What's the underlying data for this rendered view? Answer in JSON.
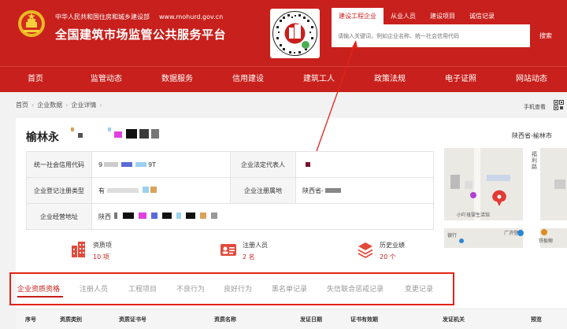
{
  "header": {
    "ministry": "中华人民共和国住房和城乡建设部",
    "url": "www.mohurd.gov.cn",
    "title": "全国建筑市场监管公共服务平台"
  },
  "search": {
    "tabs": [
      "建设工程企业",
      "从业人员",
      "建设项目",
      "诚信记录"
    ],
    "placeholder": "请输入关键词，例如企业名称、统一社会信用代码",
    "button": "搜索"
  },
  "nav": [
    "首页",
    "监管动态",
    "数据服务",
    "信用建设",
    "建筑工人",
    "政策法规",
    "电子证照",
    "网站动态"
  ],
  "breadcrumb": [
    "首页",
    "企业数据",
    "企业详情"
  ],
  "mobile_view": "手机查看",
  "company": {
    "name": "榆林永",
    "region": "陕西省-榆林市",
    "fields": [
      {
        "label": "统一社会信用代码",
        "value": "9",
        "value_tail": "9T"
      },
      {
        "label": "企业法定代表人",
        "value": ""
      },
      {
        "label": "企业登记注册类型",
        "value": "有"
      },
      {
        "label": "企业注册属地",
        "value": "陕西省-"
      },
      {
        "label": "企业经营地址",
        "value": "陕西"
      }
    ]
  },
  "map": {
    "labels": [
      "福",
      "利",
      "路",
      "小吖母婴生活馆",
      "广济堂",
      "银行",
      "铁板鲍"
    ]
  },
  "stats": [
    {
      "label": "资质项",
      "value": "10 项",
      "icon": "building-icon"
    },
    {
      "label": "注册人员",
      "value": "2 名",
      "icon": "id-card-icon"
    },
    {
      "label": "历史业绩",
      "value": "20 个",
      "icon": "layers-icon"
    }
  ],
  "tabs": [
    "企业资质资格",
    "注册人员",
    "工程项目",
    "不良行为",
    "良好行为",
    "黑名单记录",
    "失信联合惩戒记录",
    "变更记录"
  ],
  "table_headers": [
    "序号",
    "资质类别",
    "资质证书号",
    "资质名称",
    "发证日期",
    "证书有效期",
    "发证机关",
    "预览"
  ],
  "colors": {
    "brand": "#c8201c",
    "highlight": "#e2231a"
  }
}
